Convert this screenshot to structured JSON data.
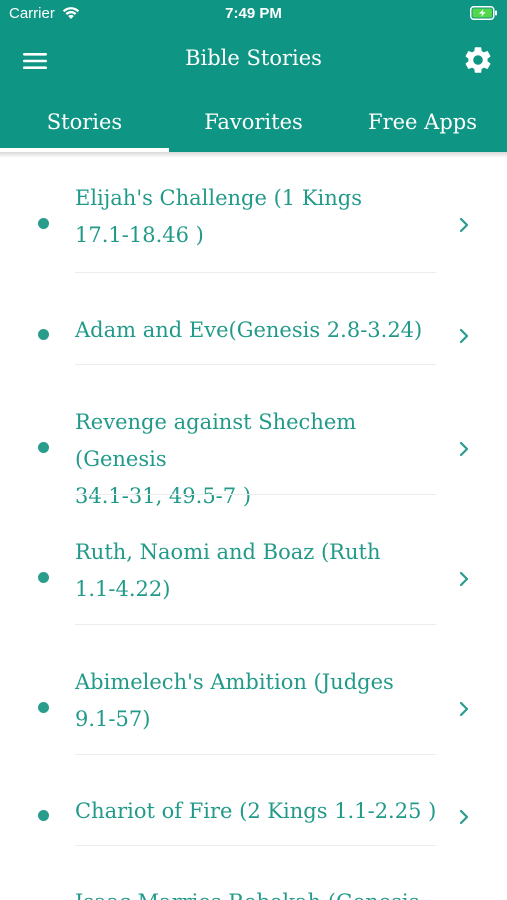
{
  "status_bar": {
    "carrier": "Carrier",
    "time": "7:49 PM"
  },
  "nav": {
    "title": "Bible Stories"
  },
  "tabs": [
    {
      "label": "Stories",
      "selected": true
    },
    {
      "label": "Favorites",
      "selected": false
    },
    {
      "label": "Free Apps",
      "selected": false
    }
  ],
  "stories": [
    {
      "line1": "Elijah's Challenge (1 Kings",
      "line2": "17.1-18.46 )"
    },
    {
      "line1": "Adam and Eve(Genesis 2.8-3.24)",
      "line2": ""
    },
    {
      "line1": "Revenge against Shechem (Genesis",
      "line2": "34.1-31,  49.5-7 )"
    },
    {
      "line1": "Ruth, Naomi and Boaz (Ruth",
      "line2": "1.1-4.22)"
    },
    {
      "line1": "Abimelech's Ambition (Judges",
      "line2": "9.1-57)"
    },
    {
      "line1": "Chariot of Fire (2 Kings 1.1-2.25 )",
      "line2": ""
    },
    {
      "line1": "Isaac Marries Rebekah (Genesis",
      "line2": ""
    }
  ],
  "colors": {
    "header": "#0f9583",
    "accent": "#229a89",
    "text_on_header": "#ffffff"
  },
  "icons": {
    "menu": "hamburger-icon",
    "settings": "gear-icon",
    "row": "chevron-right-icon",
    "bullet": "bullet-dot-icon"
  }
}
